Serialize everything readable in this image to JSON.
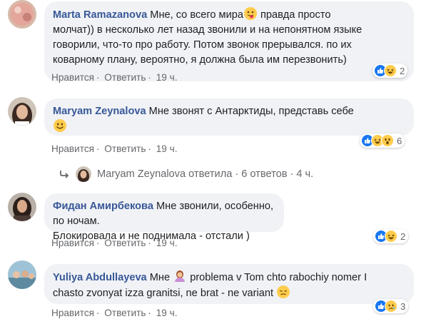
{
  "comments": [
    {
      "author": "Marta Ramazanova",
      "text_a": "Мне, со всего мира",
      "text_b": " правда просто",
      "line2": "молчат)) в несколько лет назад звонили и на непонятном языке",
      "line3": "говорили, что-то про работу. Потом звонок прерывался. по их",
      "line4": "коварному плану, вероятно, я должна была им перезвонить)",
      "like": "Нравится",
      "reply": "Ответить",
      "time": "19 ч.",
      "reaction_count": "2"
    },
    {
      "author": "Maryam Zeynalova",
      "text": "Мне звонят с Антарктиды, представь себе",
      "like": "Нравится",
      "reply": "Ответить",
      "time": "19 ч.",
      "reaction_count": "6"
    },
    {
      "author": "Фидан Амирбекова",
      "text": "Мне звонили, особенно, по ночам.",
      "line2": "Блокировала и не поднимала - отстали )",
      "like": "Нравится",
      "reply": "Ответить",
      "time": "19 ч.",
      "reaction_count": "2"
    },
    {
      "author": "Yuliya Abdullayeva",
      "text_a": "Мне",
      "text_b": "problema v Tom chto rabochiy nomer I",
      "line2": "chasto zvonyat izza granitsi, ne brat - ne variant",
      "like": "Нравится",
      "reply": "Ответить",
      "time": "19 ч.",
      "reaction_count": "3"
    }
  ],
  "reply_summary": {
    "name": "Maryam Zeynalova",
    "replied": "ответила",
    "count": "6 ответов",
    "time": "4 ч."
  },
  "separator": "·",
  "colors": {
    "author": "#385898",
    "bubble": "#f0f2f5",
    "meta": "#65676b",
    "like": "#1877f2",
    "emoji": "#ffcc4d"
  },
  "icons": [
    "reply-arrow-icon",
    "like-reaction-icon",
    "haha-reaction-icon",
    "wow-reaction-icon",
    "sad-reaction-icon"
  ]
}
